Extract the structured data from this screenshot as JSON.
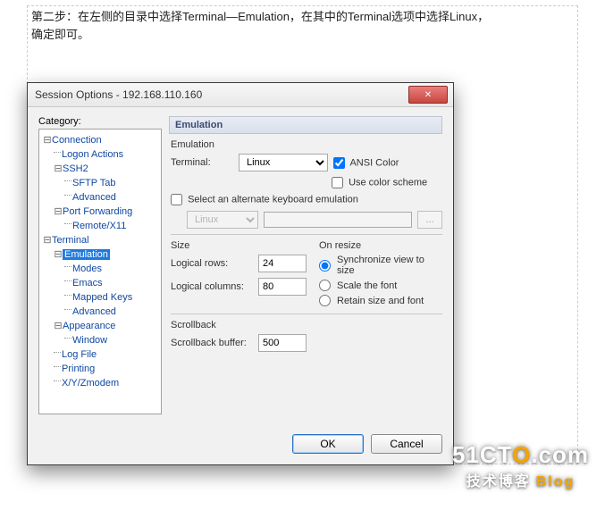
{
  "note": {
    "line1": "第二步：在左侧的目录中选择Terminal—Emulation，在其中的Terminal选项中选择Linux，",
    "line2": "确定即可。"
  },
  "dialog": {
    "title": "Session Options - 192.168.110.160",
    "close_icon": "✕",
    "category_label": "Category:",
    "tree": {
      "connection": "Connection",
      "logon_actions": "Logon Actions",
      "ssh2": "SSH2",
      "sftp_tab": "SFTP Tab",
      "advanced1": "Advanced",
      "port_forwarding": "Port Forwarding",
      "remote_x11": "Remote/X11",
      "terminal": "Terminal",
      "emulation_node": "Emulation",
      "modes": "Modes",
      "emacs": "Emacs",
      "mapped_keys": "Mapped Keys",
      "advanced2": "Advanced",
      "appearance": "Appearance",
      "window": "Window",
      "log_file": "Log File",
      "printing": "Printing",
      "xyzmodem": "X/Y/Zmodem"
    },
    "panel": {
      "header": "Emulation",
      "emul_section": "Emulation",
      "terminal_label": "Terminal:",
      "terminal_value": "Linux",
      "ansi_color": "ANSI Color",
      "use_color_scheme": "Use color scheme",
      "alt_kbd": "Select an alternate keyboard emulation",
      "alt_kbd_value": "Linux",
      "browse": "...",
      "size_section": "Size",
      "logical_rows": "Logical rows:",
      "logical_rows_val": "24",
      "logical_cols": "Logical columns:",
      "logical_cols_val": "80",
      "onresize_section": "On resize",
      "sync": "Synchronize view to size",
      "scale_font": "Scale the font",
      "retain": "Retain size and font",
      "scrollback_section": "Scrollback",
      "scrollback_buffer": "Scrollback buffer:",
      "scrollback_val": "500"
    },
    "buttons": {
      "ok": "OK",
      "cancel": "Cancel"
    }
  },
  "watermark": {
    "brand_pre": "51CT",
    "brand_dot": "O",
    "brand_post": ".com",
    "sub1": "技术博客",
    "sub2": "Blog"
  }
}
